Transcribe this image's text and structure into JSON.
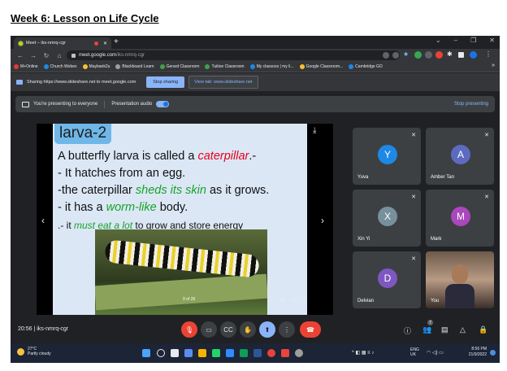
{
  "document": {
    "title": "Week 6: Lesson on Life Cycle"
  },
  "browser": {
    "tab_title": "Meet – iks-nmrq-cgr",
    "url_domain": "meet.google.com",
    "url_path": "/iks-nmrq-cgr",
    "bookmarks": [
      "M+Online",
      "Church Webex",
      "Maybank2u",
      "Blackboard Learn",
      "Gerard Classroom",
      "Tuition Classroom",
      "My classoos | my li...",
      "Google Classroom...",
      "Cambridge GO"
    ],
    "more": "»"
  },
  "sharebar": {
    "text": "Sharing https://www.slideshare.net to meet.google.com",
    "stop_label": "Stop sharing",
    "view_label": "View tab: www.slideshare.net"
  },
  "meet": {
    "presenting_text": "You're presenting to everyone",
    "presentation_audio": "Presentation audio",
    "stop_presenting": "Stop presenting",
    "meeting_time": "20:56",
    "meeting_code": "iks-nmrq-cgr",
    "people_count": "7"
  },
  "slide": {
    "title": "larva-2",
    "line1_a": "A butterfly larva is called a ",
    "line1_b": "caterpillar",
    "line1_c": ".-",
    "line2": "- It hatches from an egg.",
    "line3_a": "-the caterpillar ",
    "line3_b": "sheds its skin",
    "line3_c": " as it grows.",
    "line4_a": "- it has a ",
    "line4_b": "worm-like",
    "line4_c": " body.",
    "line5_a": ".- it ",
    "line5_b": "must eat a lot",
    "line5_c": " to grow and store energy",
    "page": "9 of 26"
  },
  "participants": [
    {
      "name": "Yuva",
      "initial": "Y",
      "color": "#1e88e5"
    },
    {
      "name": "Amber Tan",
      "initial": "A",
      "color": "#5c6bc0"
    },
    {
      "name": "Xin Yi",
      "initial": "X",
      "color": "#78909c"
    },
    {
      "name": "Mark",
      "initial": "M",
      "color": "#ab47bc"
    },
    {
      "name": "Delvian",
      "initial": "D",
      "color": "#7e57c2"
    },
    {
      "name": "You",
      "initial": ""
    }
  ],
  "taskbar": {
    "temperature": "27°C",
    "weather": "Partly cloudy",
    "lang1": "ENG",
    "lang2": "UK",
    "time": "8:56 PM",
    "date": "21/9/2022"
  }
}
